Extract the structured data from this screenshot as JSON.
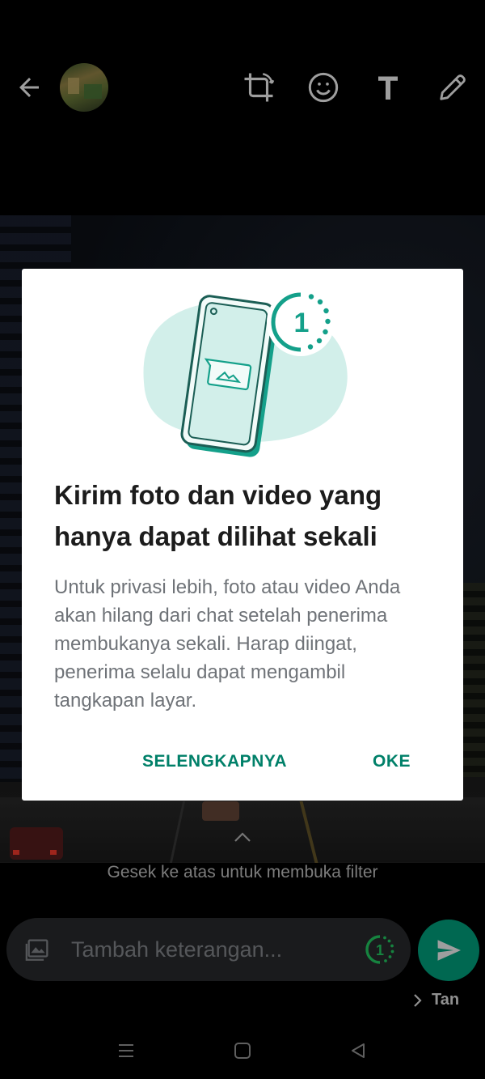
{
  "toolbar": {
    "icons": [
      "back-arrow-icon",
      "crop-rotate-icon",
      "emoji-icon",
      "text-icon",
      "pencil-icon"
    ]
  },
  "swipe_hint": "Gesek ke atas untuk membuka filter",
  "caption": {
    "placeholder": "Tambah keterangan...",
    "view_once_number": "1"
  },
  "recipient": {
    "label": "Tan"
  },
  "dialog": {
    "badge_number": "1",
    "title": "Kirim foto dan video yang hanya dapat dilihat sekali",
    "body": "Untuk privasi lebih, foto atau video Anda akan hilang dari chat setelah penerima membukanya sekali. Harap diingat, penerima selalu dapat mengambil tangkapan layar.",
    "learn_more": "SELENGKAPNYA",
    "ok": "OKE"
  },
  "colors": {
    "accent": "#008069",
    "send": "#00a884",
    "illustration": "#d2efea"
  }
}
